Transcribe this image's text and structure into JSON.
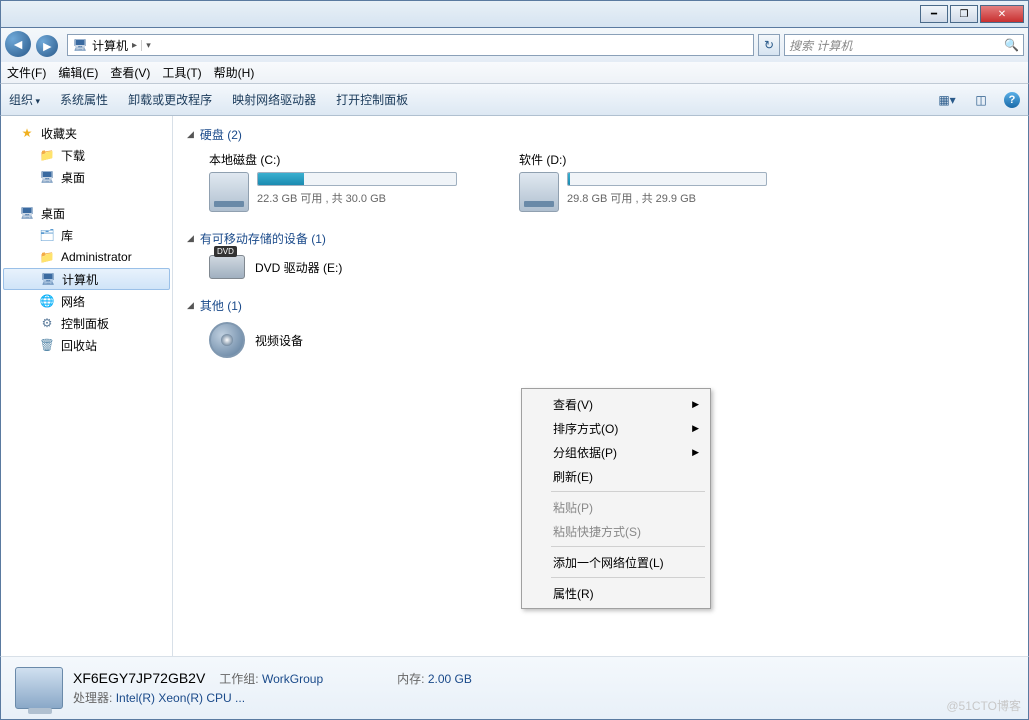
{
  "titlebar": {
    "min": "━",
    "max": "❐",
    "close": "✕"
  },
  "nav": {
    "breadcrumb_icon": "computer",
    "breadcrumb": "计算机",
    "breadcrumb_sep": "▸",
    "search_placeholder": "搜索 计算机"
  },
  "menubar": [
    "文件(F)",
    "编辑(E)",
    "查看(V)",
    "工具(T)",
    "帮助(H)"
  ],
  "toolbar": {
    "organize": "组织",
    "items": [
      "系统属性",
      "卸载或更改程序",
      "映射网络驱动器",
      "打开控制面板"
    ]
  },
  "sidebar": {
    "fav": "收藏夹",
    "fav_items": [
      "下载",
      "桌面"
    ],
    "desk": "桌面",
    "desk_items": [
      "库",
      "Administrator",
      "计算机",
      "网络",
      "控制面板",
      "回收站"
    ]
  },
  "content": {
    "hdd_header": "硬盘 (2)",
    "drives": [
      {
        "name": "本地磁盘 (C:)",
        "fill": 23,
        "stat": "22.3 GB 可用 , 共 30.0 GB"
      },
      {
        "name": "软件 (D:)",
        "fill": 1,
        "stat": "29.8 GB 可用 , 共 29.9 GB"
      }
    ],
    "removable_header": "有可移动存储的设备 (1)",
    "dvd": "DVD 驱动器 (E:)",
    "other_header": "其他 (1)",
    "video": "视频设备"
  },
  "ctx": {
    "view": "查看(V)",
    "sort": "排序方式(O)",
    "group": "分组依据(P)",
    "refresh": "刷新(E)",
    "paste": "粘贴(P)",
    "paste_shortcut": "粘贴快捷方式(S)",
    "add_net": "添加一个网络位置(L)",
    "props": "属性(R)"
  },
  "details": {
    "name": "XF6EGY7JP72GB2V",
    "wg_lbl": "工作组:",
    "wg_val": "WorkGroup",
    "mem_lbl": "内存:",
    "mem_val": "2.00 GB",
    "cpu_lbl": "处理器:",
    "cpu_val": "Intel(R) Xeon(R) CPU ..."
  },
  "watermark": "@51CTO博客"
}
